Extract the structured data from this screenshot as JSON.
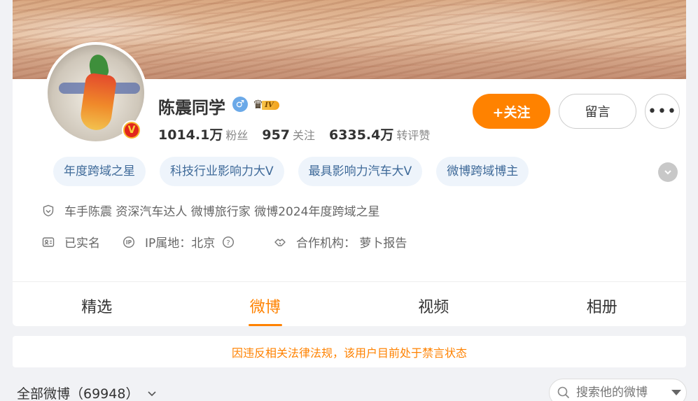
{
  "profile": {
    "name": "陈震同学",
    "level": "IV",
    "verified_badge": "V",
    "stats": [
      {
        "value": "1014.1万",
        "label": "粉丝"
      },
      {
        "value": "957",
        "label": "关注"
      },
      {
        "value": "6335.4万",
        "label": "转评赞"
      }
    ]
  },
  "actions": {
    "follow": "+关注",
    "message": "留言",
    "more": "•••"
  },
  "tags": [
    "年度跨域之星",
    "科技行业影响力大V",
    "最具影响力汽车大V",
    "微博跨域博主"
  ],
  "info": {
    "bio": "车手陈震 资深汽车达人 微博旅行家 微博2024年度跨域之星",
    "realname": "已实名",
    "ip": "IP属地：北京",
    "org": "合作机构：  萝卜报告"
  },
  "tabs": [
    "精选",
    "微博",
    "视频",
    "相册"
  ],
  "active_tab": "微博",
  "notice": "因违反相关法律法规，该用户目前处于禁言状态",
  "feed": {
    "all_label": "全部微博（69948）",
    "search_placeholder": "搜索他的微博"
  },
  "colors": {
    "accent": "#ff8200",
    "tag_text": "#3f6a99",
    "tag_bg": "#eef4fb"
  },
  "icons": [
    "shield-icon",
    "id-card-icon",
    "ip-icon",
    "help-icon",
    "handshake-icon",
    "search-icon",
    "chevron-down-icon",
    "male-icon",
    "crown-icon"
  ]
}
